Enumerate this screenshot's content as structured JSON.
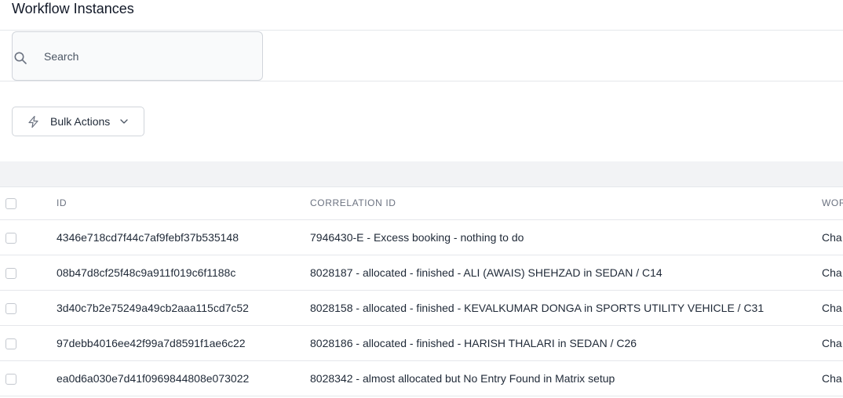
{
  "header": {
    "title": "Workflow Instances"
  },
  "search": {
    "placeholder": "Search",
    "icon": "search-icon"
  },
  "toolbar": {
    "bulk_actions_label": "Bulk Actions",
    "icon": "bolt-icon"
  },
  "table": {
    "columns": [
      "ID",
      "CORRELATION ID",
      "WOR"
    ],
    "rows": [
      {
        "id": "4346e718cd7f44c7af9febf37b535148",
        "correlation_id": "7946430-E - Excess booking - nothing to do",
        "workflow": "Cha"
      },
      {
        "id": "08b47d8cf25f48c9a911f019c6f1188c",
        "correlation_id": "8028187 - allocated - finished - ALI (AWAIS) SHEHZAD in SEDAN / C14",
        "workflow": "Cha"
      },
      {
        "id": "3d40c7b2e75249a49cb2aaa115cd7c52",
        "correlation_id": "8028158 - allocated - finished - KEVALKUMAR DONGA in SPORTS UTILITY VEHICLE / C31",
        "workflow": "Cha"
      },
      {
        "id": "97debb4016ee42f99a7d8591f1ae6c22",
        "correlation_id": "8028186 - allocated - finished - HARISH THALARI in SEDAN / C26",
        "workflow": "Cha"
      },
      {
        "id": "ea0d6a030e7d41f0969844808e073022",
        "correlation_id": "8028342 - almost allocated but No Entry Found in Matrix setup",
        "workflow": "Cha"
      }
    ]
  }
}
